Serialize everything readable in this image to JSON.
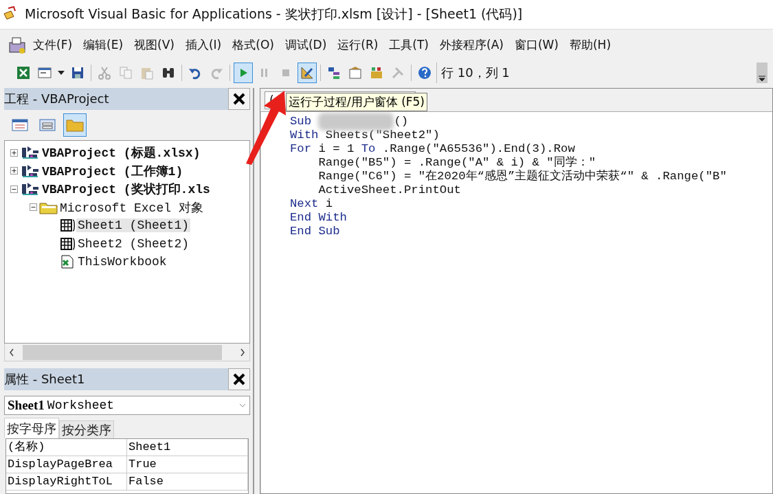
{
  "window": {
    "title": "Microsoft Visual Basic for Applications - 奖状打印.xlsm [设计] - [Sheet1 (代码)]"
  },
  "menu": [
    "文件(F)",
    "编辑(E)",
    "视图(V)",
    "插入(I)",
    "格式(O)",
    "调试(D)",
    "运行(R)",
    "工具(T)",
    "外接程序(A)",
    "窗口(W)",
    "帮助(H)"
  ],
  "toolbar": {
    "buttons": [
      {
        "kind": "excel",
        "disabled": false,
        "pressed": false
      },
      {
        "kind": "form",
        "disabled": false,
        "pressed": false
      },
      {
        "kind": "dropdown",
        "disabled": false,
        "pressed": false
      },
      {
        "kind": "save",
        "disabled": false,
        "pressed": false
      },
      {
        "kind": "sep"
      },
      {
        "kind": "cut",
        "disabled": true,
        "pressed": false
      },
      {
        "kind": "copy",
        "disabled": true,
        "pressed": false
      },
      {
        "kind": "paste",
        "disabled": true,
        "pressed": false
      },
      {
        "kind": "find",
        "disabled": false,
        "pressed": false
      },
      {
        "kind": "sep"
      },
      {
        "kind": "undo",
        "disabled": false,
        "pressed": false
      },
      {
        "kind": "redo",
        "disabled": true,
        "pressed": false
      },
      {
        "kind": "sep"
      },
      {
        "kind": "run",
        "disabled": false,
        "pressed": true
      },
      {
        "kind": "pause",
        "disabled": true,
        "pressed": false
      },
      {
        "kind": "stop",
        "disabled": true,
        "pressed": false
      },
      {
        "kind": "design",
        "disabled": false,
        "pressed": true
      },
      {
        "kind": "sep"
      },
      {
        "kind": "project",
        "disabled": false,
        "pressed": false
      },
      {
        "kind": "properties",
        "disabled": false,
        "pressed": false
      },
      {
        "kind": "objects",
        "disabled": false,
        "pressed": false
      },
      {
        "kind": "tools",
        "disabled": true,
        "pressed": false
      },
      {
        "kind": "sep"
      },
      {
        "kind": "help",
        "disabled": false,
        "pressed": false
      }
    ],
    "position": "行 10，列 1"
  },
  "tooltip": "运行子过程/用户窗体 (F5)",
  "project_pane": {
    "title": "工程 - VBAProject",
    "buttons": [
      {
        "kind": "view-code",
        "pressed": false
      },
      {
        "kind": "view-object",
        "pressed": false
      },
      {
        "kind": "folders",
        "pressed": true
      }
    ],
    "tree": [
      {
        "label": "VBAProject (标题.xlsx)",
        "kind": "project",
        "expanded": false,
        "selected": false
      },
      {
        "label": "VBAProject (工作簿1)",
        "kind": "project",
        "expanded": false,
        "selected": false
      },
      {
        "label": "VBAProject (奖状打印.xls",
        "kind": "project",
        "expanded": true,
        "selected": false,
        "children": [
          {
            "label": "Microsoft Excel 对象",
            "kind": "folder",
            "expanded": true,
            "selected": false,
            "children": [
              {
                "label": "Sheet1 (Sheet1)",
                "kind": "sheet",
                "selected": true
              },
              {
                "label": "Sheet2 (Sheet2)",
                "kind": "sheet",
                "selected": false
              },
              {
                "label": "ThisWorkbook",
                "kind": "workbook",
                "selected": false
              }
            ]
          }
        ]
      }
    ]
  },
  "properties_pane": {
    "title": "属性 - Sheet1",
    "object_name": "Sheet1",
    "object_type": "Worksheet",
    "tabs": [
      {
        "label": "按字母序",
        "selected": true
      },
      {
        "label": "按分类序",
        "selected": false
      }
    ],
    "rows": [
      {
        "name": "(名称)",
        "value": "Sheet1"
      },
      {
        "name": "DisplayPageBrea",
        "value": "True"
      },
      {
        "name": "DisplayRightToL",
        "value": "False"
      }
    ]
  },
  "code_window": {
    "object_combo": "(",
    "lines": [
      [
        {
          "text": "Sub ",
          "kind": "keyword"
        },
        {
          "kind": "blurred"
        },
        {
          "text": "()",
          "kind": "plain"
        }
      ],
      [
        {
          "text": "With ",
          "kind": "keyword"
        },
        {
          "text": "Sheets(\"Sheet2\")",
          "kind": "plain"
        }
      ],
      [
        {
          "text": "For ",
          "kind": "keyword"
        },
        {
          "text": "i = 1 ",
          "kind": "plain"
        },
        {
          "text": "To ",
          "kind": "keyword"
        },
        {
          "text": ".Range(\"A65536\").End(3).Row",
          "kind": "plain"
        }
      ],
      [
        {
          "text": "    Range(\"B5\") = .Range(\"A\" & i) & \"同学：\"",
          "kind": "plain"
        }
      ],
      [
        {
          "text": "    Range(\"C6\") = \"在2020年“感恩”主题征文活动中荣获“\" & .Range(\"B\"",
          "kind": "plain"
        }
      ],
      [
        {
          "text": "    ActiveSheet.PrintOut",
          "kind": "plain"
        }
      ],
      [
        {
          "text": "Next ",
          "kind": "keyword"
        },
        {
          "text": "i",
          "kind": "plain"
        }
      ],
      [
        {
          "text": "End With",
          "kind": "keyword"
        }
      ],
      [
        {
          "text": "End Sub",
          "kind": "keyword"
        }
      ]
    ]
  }
}
